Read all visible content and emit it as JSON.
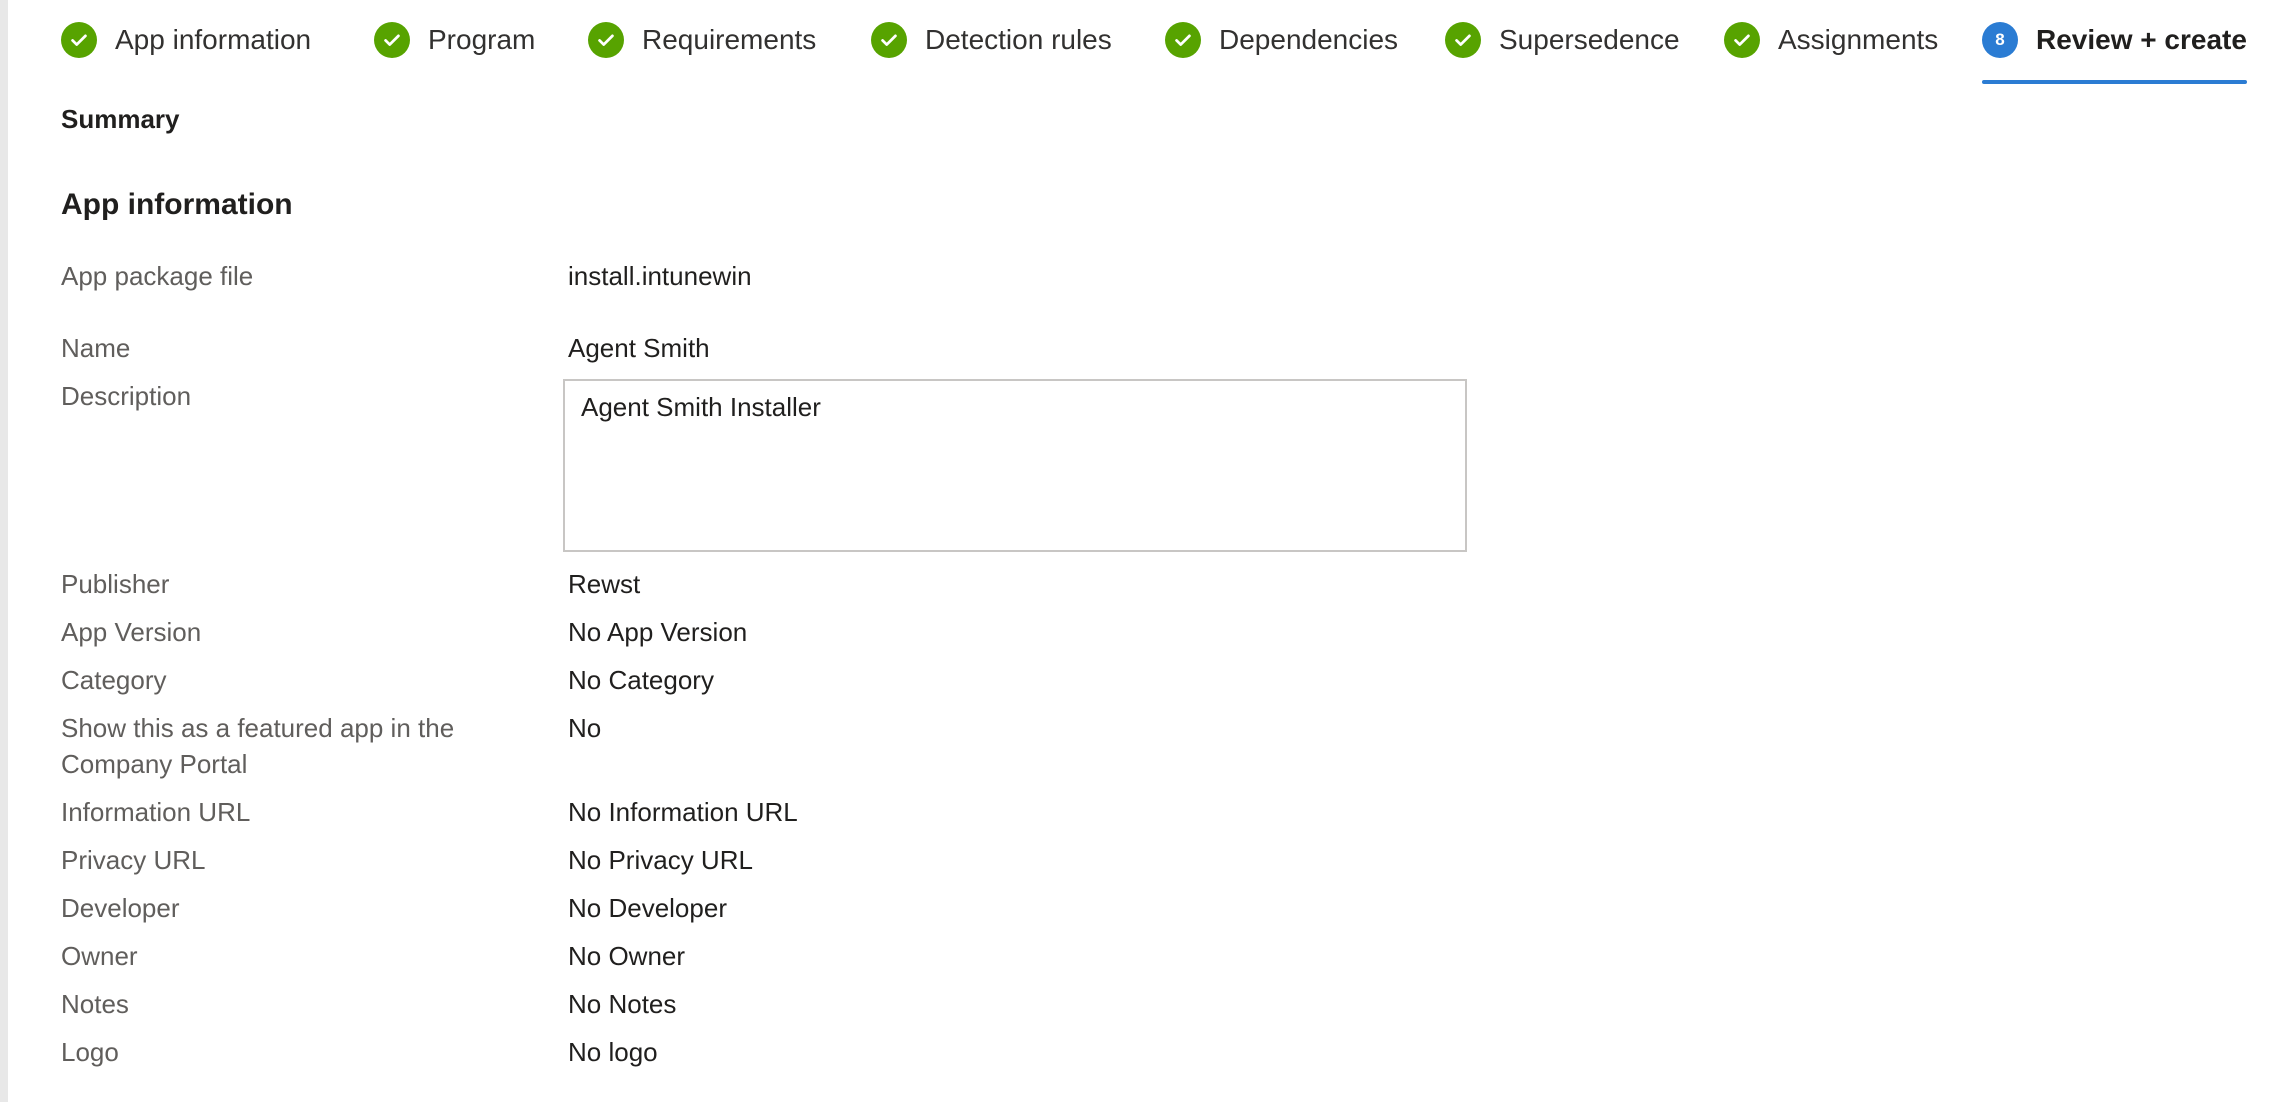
{
  "wizard": {
    "steps": [
      {
        "label": "App information",
        "status": "complete"
      },
      {
        "label": "Program",
        "status": "complete"
      },
      {
        "label": "Requirements",
        "status": "complete"
      },
      {
        "label": "Detection rules",
        "status": "complete"
      },
      {
        "label": "Dependencies",
        "status": "complete"
      },
      {
        "label": "Supersedence",
        "status": "complete"
      },
      {
        "label": "Assignments",
        "status": "complete"
      },
      {
        "label": "Review + create",
        "status": "current",
        "number": "8"
      }
    ]
  },
  "summary_title": "Summary",
  "section_title": "App information",
  "fields": {
    "package_file": {
      "label": "App package file",
      "value": "install.intunewin"
    },
    "name": {
      "label": "Name",
      "value": "Agent Smith"
    },
    "description": {
      "label": "Description",
      "value": "Agent Smith Installer"
    },
    "publisher": {
      "label": "Publisher",
      "value": "Rewst"
    },
    "app_version": {
      "label": "App Version",
      "value": "No App Version"
    },
    "category": {
      "label": "Category",
      "value": "No Category"
    },
    "featured": {
      "label": "Show this as a featured app in the Company Portal",
      "value": "No"
    },
    "information_url": {
      "label": "Information URL",
      "value": "No Information URL"
    },
    "privacy_url": {
      "label": "Privacy URL",
      "value": "No Privacy URL"
    },
    "developer": {
      "label": "Developer",
      "value": "No Developer"
    },
    "owner": {
      "label": "Owner",
      "value": "No Owner"
    },
    "notes": {
      "label": "Notes",
      "value": "No Notes"
    },
    "logo": {
      "label": "Logo",
      "value": "No logo"
    }
  },
  "colors": {
    "complete": "#57a300",
    "current": "#2b7cd3",
    "label_text": "#605e5c",
    "value_text": "#201f1e"
  },
  "icons": {
    "complete": "checkmark-icon"
  }
}
